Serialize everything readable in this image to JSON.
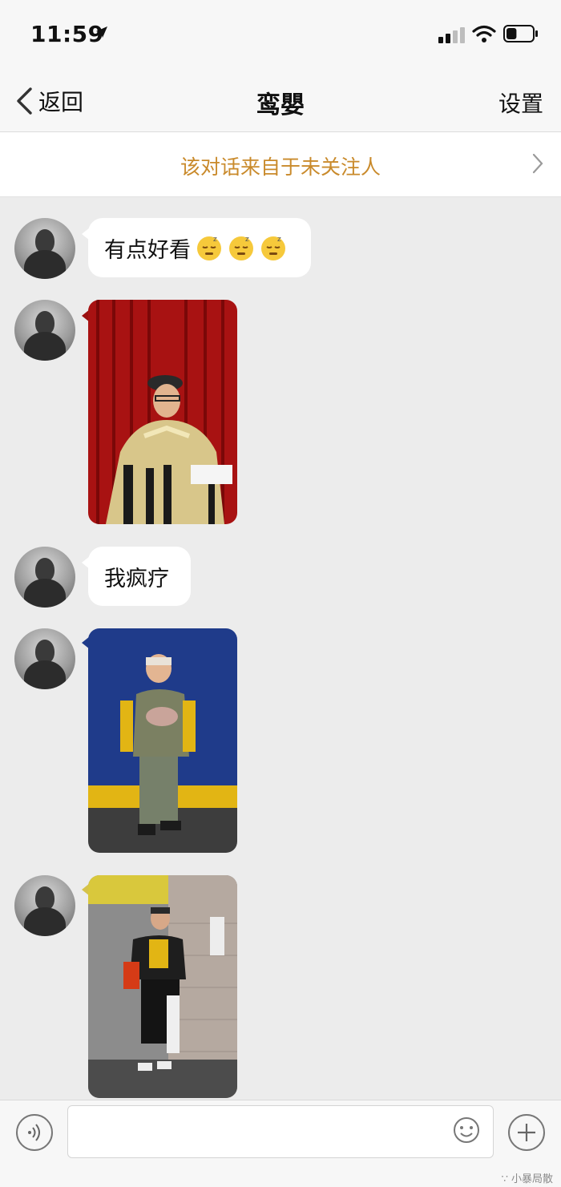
{
  "status_bar": {
    "time": "11:59",
    "location_icon": "location-arrow-icon",
    "signal_icon": "cellular-signal-icon",
    "wifi_icon": "wifi-icon",
    "battery_icon": "battery-icon",
    "battery_level": 0.4
  },
  "nav": {
    "back_label": "返回",
    "title": "鸾嬰",
    "settings_label": "设置"
  },
  "notice": {
    "text": "该对话来自于未关注人"
  },
  "messages": [
    {
      "type": "text",
      "text": "有点好看",
      "emoji": [
        "sleepy-face-emoji",
        "sleepy-face-emoji",
        "sleepy-face-emoji"
      ]
    },
    {
      "type": "image",
      "subject": "photo-red-curtain"
    },
    {
      "type": "text",
      "text": "我疯疗"
    },
    {
      "type": "image",
      "subject": "photo-blue-wall"
    },
    {
      "type": "image",
      "subject": "photo-street-wall"
    }
  ],
  "input": {
    "placeholder": ""
  },
  "watermark": "∵ 小暴局散"
}
